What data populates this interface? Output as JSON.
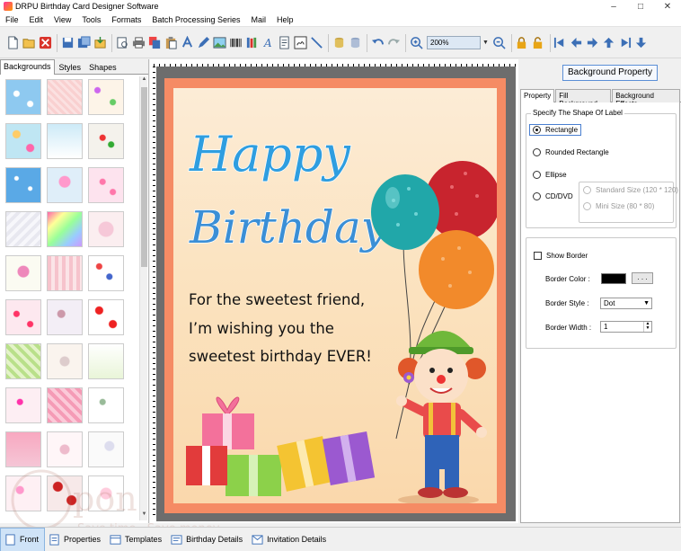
{
  "window": {
    "title": "DRPU Birthday Card Designer Software",
    "min": "–",
    "max": "□",
    "close": "✕"
  },
  "menu": [
    "File",
    "Edit",
    "View",
    "Tools",
    "Formats",
    "Batch Processing Series",
    "Mail",
    "Help"
  ],
  "toolbar": {
    "zoom_value": "200%"
  },
  "left_panel": {
    "tabs": [
      "Backgrounds",
      "Styles",
      "Shapes"
    ],
    "active_tab": "Backgrounds"
  },
  "card": {
    "heading_line1": "Happy",
    "heading_line2": "Birthday",
    "message": [
      "For the sweetest friend,",
      "I’m wishing you the",
      "sweetest birthday EVER!"
    ]
  },
  "right_panel": {
    "title": "Background Property",
    "tabs": [
      "Property",
      "Fill Background",
      "Background Effects"
    ],
    "shape_group_label": "Specify The Shape Of Label",
    "shapes": [
      "Rectangle",
      "Rounded Rectangle",
      "Ellipse",
      "CD/DVD"
    ],
    "selected_shape": "Rectangle",
    "cd_sizes": [
      "Standard Size (120 * 120)",
      "Mini Size (80 * 80)"
    ],
    "show_border_label": "Show Border",
    "border_color_label": "Border Color :",
    "border_color": "#000000",
    "browse_label": ". . .",
    "border_style_label": "Border Style :",
    "border_style_value": "Dot",
    "border_width_label": "Border Width :",
    "border_width_value": "1"
  },
  "bottom_tabs": [
    "Front",
    "Properties",
    "Templates",
    "Birthday Details",
    "Invitation Details"
  ],
  "watermark": {
    "line1": "pon",
    "line2": "Save time · Save money"
  },
  "colors": {
    "accent": "#5b8fd6",
    "card_border": "#f58b64",
    "frame": "#6d6d6d"
  }
}
